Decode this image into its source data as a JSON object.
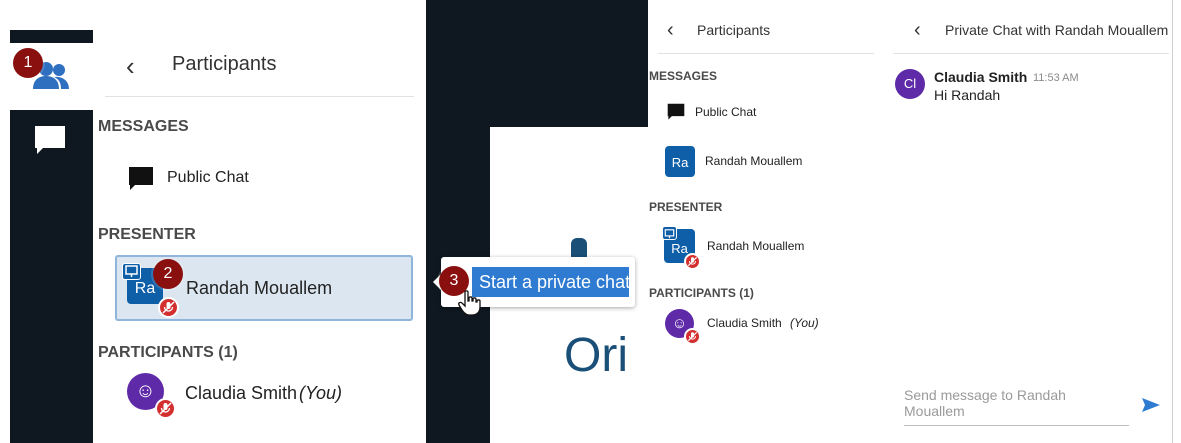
{
  "steps": [
    "1",
    "2",
    "3"
  ],
  "panel1": {
    "header": {
      "back": "‹",
      "title": "Participants"
    },
    "messages_heading": "MESSAGES",
    "public_chat": "Public Chat",
    "presenter_heading": "PRESENTER",
    "presenter": {
      "initials": "Ra",
      "name": "Randah Mouallem"
    },
    "participants_heading": "PARTICIPANTS (1)",
    "participant": {
      "avatar": "☺",
      "name": "Claudia Smith",
      "you": "(You)"
    }
  },
  "stage": {
    "slide_text": "Ori"
  },
  "tooltip": {
    "label": "Start a private chat"
  },
  "panel2": {
    "header": {
      "back": "‹",
      "title": "Participants"
    },
    "messages_heading": "MESSAGES",
    "public_chat": "Public Chat",
    "private_chat": {
      "initials": "Ra",
      "name": "Randah Mouallem"
    },
    "presenter_heading": "PRESENTER",
    "presenter": {
      "initials": "Ra",
      "name": "Randah Mouallem"
    },
    "participants_heading": "PARTICIPANTS (1)",
    "participant": {
      "avatar": "☺",
      "name": "Claudia Smith",
      "you": "(You)"
    }
  },
  "chat": {
    "header": {
      "back": "‹",
      "title": "Private Chat with Randah Mouallem"
    },
    "message": {
      "initials": "Cl",
      "name": "Claudia Smith",
      "time": "11:53 AM",
      "text": "Hi Randah"
    },
    "compose_placeholder": "Send message to Randah Mouallem"
  },
  "colors": {
    "dark_bg": "#0f1820",
    "accent_blue": "#0f5ea8",
    "button_blue": "#2f7bd1",
    "purple_avatar": "#5e2aa7",
    "step_badge": "#8a1010",
    "mic_off_red": "#d32f2f"
  }
}
